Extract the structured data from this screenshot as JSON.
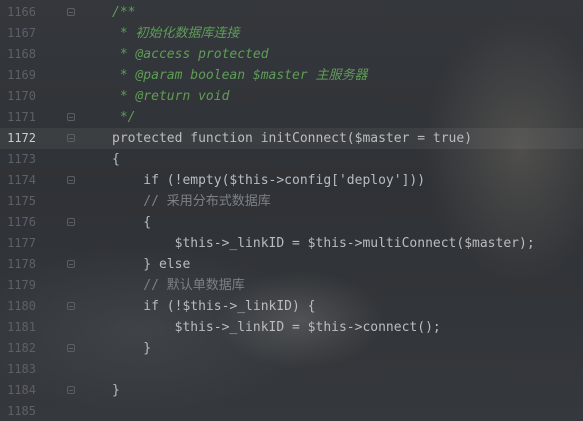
{
  "editor": {
    "current_line": "1172",
    "lines": [
      {
        "num": "1166",
        "code": "/**"
      },
      {
        "num": "1167",
        "code": " * 初始化数据库连接"
      },
      {
        "num": "1168",
        "code": " * @access protected"
      },
      {
        "num": "1169",
        "code": " * @param boolean $master 主服务器"
      },
      {
        "num": "1170",
        "code": " * @return void"
      },
      {
        "num": "1171",
        "code": " */"
      },
      {
        "num": "1172",
        "code": "protected function initConnect($master = true)"
      },
      {
        "num": "1173",
        "code": "{"
      },
      {
        "num": "1174",
        "code": "    if (!empty($this->config['deploy']))"
      },
      {
        "num": "1175",
        "code": "    // 采用分布式数据库"
      },
      {
        "num": "1176",
        "code": "    {"
      },
      {
        "num": "1177",
        "code": "        $this->_linkID = $this->multiConnect($master);"
      },
      {
        "num": "1178",
        "code": "    } else"
      },
      {
        "num": "1179",
        "code": "    // 默认单数据库"
      },
      {
        "num": "1180",
        "code": "    if (!$this->_linkID) {"
      },
      {
        "num": "1181",
        "code": "        $this->_linkID = $this->connect();"
      },
      {
        "num": "1182",
        "code": "    }"
      },
      {
        "num": "1183",
        "code": ""
      },
      {
        "num": "1184",
        "code": "}"
      },
      {
        "num": "1185",
        "code": ""
      }
    ]
  }
}
